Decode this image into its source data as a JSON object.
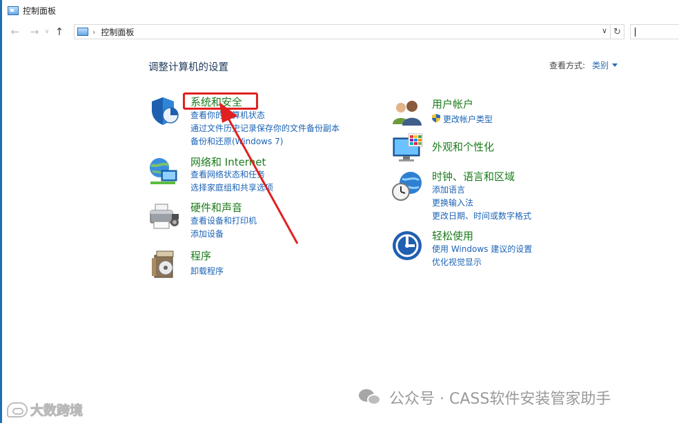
{
  "window": {
    "title": "控制面板"
  },
  "address": {
    "path": "控制面板"
  },
  "main": {
    "title": "调整计算机的设置",
    "view_by_label": "查看方式:",
    "view_by_value": "类别"
  },
  "categories": {
    "system_security": {
      "title": "系统和安全",
      "links": [
        "查看你的计算机状态",
        "通过文件历史记录保存你的文件备份副本",
        "备份和还原(Windows 7)"
      ]
    },
    "network": {
      "title": "网络和 Internet",
      "links": [
        "查看网络状态和任务",
        "选择家庭组和共享选项"
      ]
    },
    "hardware": {
      "title": "硬件和声音",
      "links": [
        "查看设备和打印机",
        "添加设备"
      ]
    },
    "programs": {
      "title": "程序",
      "links": [
        "卸载程序"
      ]
    },
    "user_accounts": {
      "title": "用户帐户",
      "links": [
        "更改帐户类型"
      ]
    },
    "appearance": {
      "title": "外观和个性化",
      "links": []
    },
    "clock_region": {
      "title": "时钟、语言和区域",
      "links": [
        "添加语言",
        "更换输入法",
        "更改日期、时间或数字格式"
      ]
    },
    "ease_of_access": {
      "title": "轻松使用",
      "links": [
        "使用 Windows 建议的设置",
        "优化视觉显示"
      ]
    }
  },
  "watermarks": {
    "left": "大数跨境",
    "right": "公众号 · CASS软件安装管家助手"
  },
  "colors": {
    "category_title": "#1a7c1a",
    "link": "#1b63b5",
    "annotation": "#e02020",
    "window_edge": "#1f6fb3"
  }
}
